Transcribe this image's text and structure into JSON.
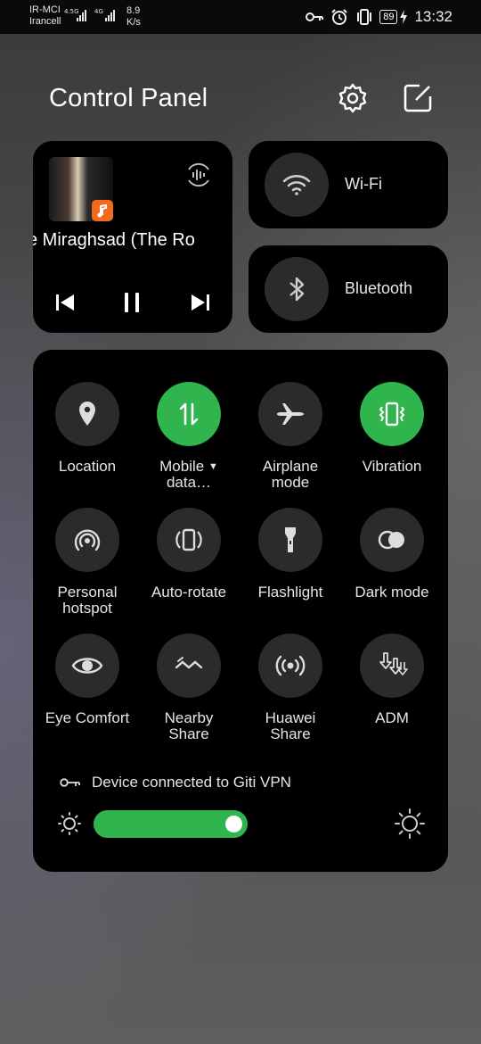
{
  "status_bar": {
    "carrier_line1": "IR-MCI",
    "carrier_line2": "Irancell",
    "net1": "4.5G",
    "net2": "4G",
    "speed_value": "8.9",
    "speed_unit": "K/s",
    "battery": "89",
    "time": "13:32"
  },
  "header": {
    "title": "Control Panel"
  },
  "media": {
    "song_text": "e Miraghsad (The Ro",
    "app_icon": "music-icon"
  },
  "tiles": {
    "wifi_label": "Wi-Fi",
    "bluetooth_label": "Bluetooth"
  },
  "quick_settings": {
    "location": "Location",
    "mobile_data_1": "Mobile",
    "mobile_data_dropdown": "▼",
    "mobile_data_2": "data…",
    "airplane_1": "Airplane",
    "airplane_2": "mode",
    "vibration": "Vibration",
    "hotspot_1": "Personal",
    "hotspot_2": "hotspot",
    "auto_rotate": "Auto-rotate",
    "flashlight": "Flashlight",
    "dark_mode": "Dark mode",
    "eye_comfort": "Eye Comfort",
    "nearby_1": "Nearby",
    "nearby_2": "Share",
    "huawei_1": "Huawei",
    "huawei_2": "Share",
    "adm": "ADM"
  },
  "vpn": {
    "text": "Device connected to Giti VPN"
  },
  "brightness": {
    "level": 0.92
  },
  "colors": {
    "accent": "#2fb44e",
    "card": "#000000",
    "circle": "#2b2b2b"
  }
}
